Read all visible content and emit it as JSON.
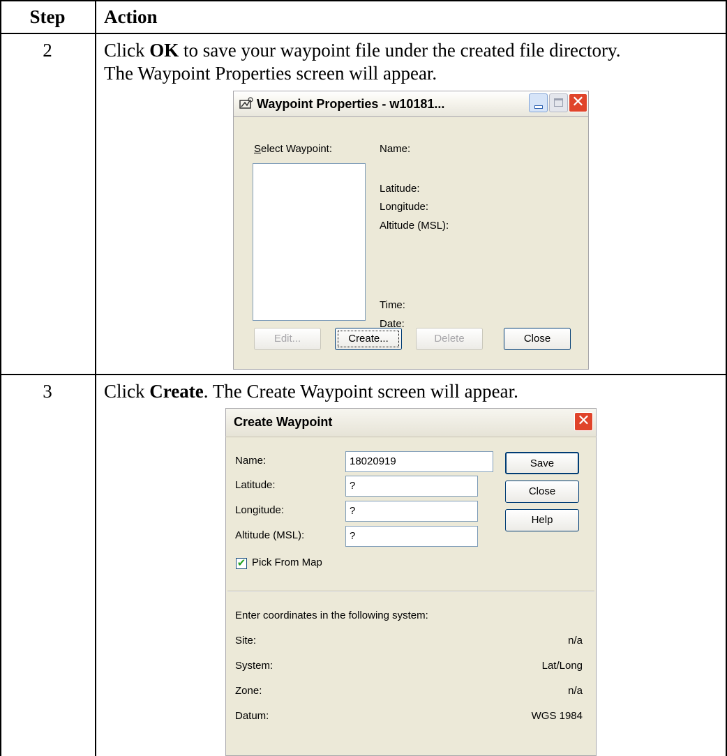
{
  "table": {
    "header": {
      "step": "Step",
      "action": "Action"
    },
    "rows": [
      {
        "step": "2",
        "line1_pre": "Click ",
        "line1_bold": "OK",
        "line1_post": " to save your waypoint file under the created file directory.",
        "line2": "The Waypoint Properties screen will appear."
      },
      {
        "step": "3",
        "line1_pre": "Click ",
        "line1_bold": "Create",
        "line1_post": ".  The Create Waypoint screen will appear."
      }
    ]
  },
  "waypoint_properties": {
    "title": "Waypoint Properties - w10181...",
    "select_label_u": "S",
    "select_label_rest": "elect Waypoint:",
    "fields": [
      "Name:",
      "Latitude:",
      "Longitude:",
      "Altitude (MSL):",
      "Time:",
      "Date:"
    ],
    "buttons": {
      "edit": "Edit...",
      "create": "Create...",
      "delete": "Delete",
      "close": "Close"
    }
  },
  "create_waypoint": {
    "title": "Create Waypoint",
    "labels": [
      "Name:",
      "Latitude:",
      "Longitude:",
      "Altitude (MSL):"
    ],
    "values": [
      "18020919",
      "?",
      "?",
      "?"
    ],
    "buttons": {
      "save": "Save",
      "close": "Close",
      "help": "Help"
    },
    "pick_from_map": {
      "label": "Pick From Map",
      "checked": true
    },
    "coord_intro": "Enter coordinates in the following system:",
    "coords": [
      {
        "label": "Site:",
        "value": "n/a"
      },
      {
        "label": "System:",
        "value": "Lat/Long"
      },
      {
        "label": "Zone:",
        "value": "n/a"
      },
      {
        "label": "Datum:",
        "value": "WGS 1984"
      }
    ]
  },
  "colors": {
    "xp_title_blue": "#0a56e0",
    "xp_close_red": "#e0442a",
    "dialog_face": "#ece9d8"
  }
}
